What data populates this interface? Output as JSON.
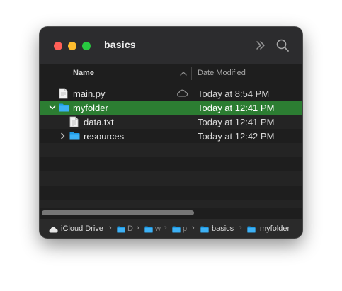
{
  "window": {
    "title": "basics",
    "colors": {
      "close": "#ff5f57",
      "minimize": "#febc2e",
      "maximize": "#28c840",
      "selection": "#2c7d32",
      "folder": "#1e9be6"
    }
  },
  "toolbar": {
    "more_icon": "double-chevron-right",
    "search_icon": "magnifying-glass"
  },
  "columns": {
    "name": "Name",
    "date_modified": "Date Modified"
  },
  "files": [
    {
      "name": "main.py",
      "date": "Today at 8:54 PM",
      "kind": "file",
      "indent": 0,
      "cloud": true,
      "selected": false
    },
    {
      "name": "myfolder",
      "date": "Today at 12:41 PM",
      "kind": "folder",
      "indent": 0,
      "expanded": true,
      "selected": true
    },
    {
      "name": "data.txt",
      "date": "Today at 12:41 PM",
      "kind": "file",
      "indent": 1,
      "selected": false
    },
    {
      "name": "resources",
      "date": "Today at 12:42 PM",
      "kind": "folder",
      "indent": 1,
      "expanded": false,
      "selected": false
    }
  ],
  "pathbar": {
    "items": [
      {
        "label": "iCloud Drive"
      },
      {
        "label": "D"
      },
      {
        "label": "w"
      },
      {
        "label": "p"
      },
      {
        "label": "basics"
      },
      {
        "label": "myfolder"
      }
    ]
  }
}
